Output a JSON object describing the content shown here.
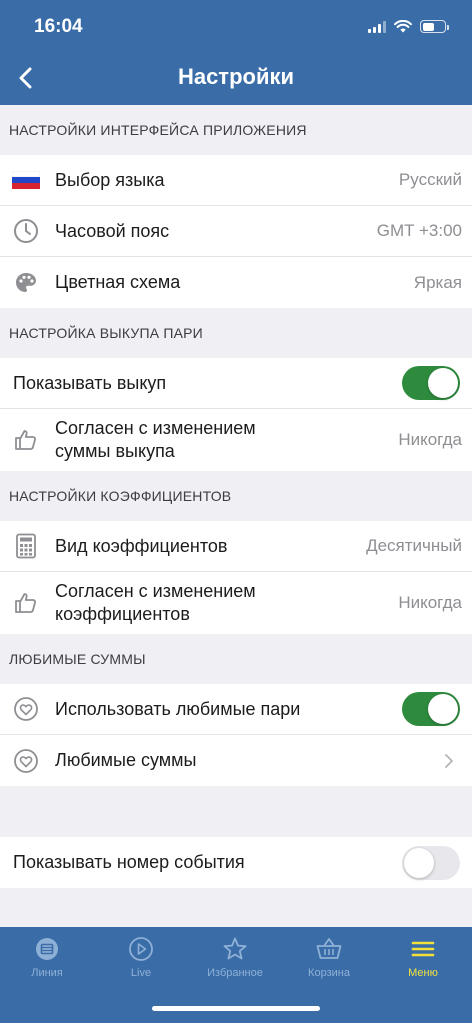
{
  "status": {
    "time": "16:04"
  },
  "nav": {
    "title": "Настройки"
  },
  "sections": {
    "interface": "НАСТРОЙКИ ИНТЕРФЕЙСА ПРИЛОЖЕНИЯ",
    "buyout": "НАСТРОЙКА ВЫКУПА ПАРИ",
    "coefficients": "НАСТРОЙКИ КОЭФФИЦИЕНТОВ",
    "favorites": "ЛЮБИМЫЕ СУММЫ"
  },
  "interface": {
    "language": {
      "label": "Выбор языка",
      "value": "Русский",
      "icon": "russia-flag-icon"
    },
    "timezone": {
      "label": "Часовой пояс",
      "value": "GMT +3:00",
      "icon": "clock-icon"
    },
    "theme": {
      "label": "Цветная схема",
      "value": "Яркая",
      "icon": "palette-icon"
    }
  },
  "buyout": {
    "show": {
      "label": "Показывать выкуп",
      "enabled": true
    },
    "agree": {
      "label_line1": "Согласен с изменением",
      "label_line2": "суммы выкупа",
      "value": "Никогда",
      "icon": "thumbs-up-icon"
    }
  },
  "coefficients": {
    "view": {
      "label": "Вид коэффициентов",
      "value": "Десятичный",
      "icon": "calculator-icon"
    },
    "agree": {
      "label_line1": "Согласен с изменением",
      "label_line2": "коэффициентов",
      "value": "Никогда",
      "icon": "thumbs-up-icon"
    }
  },
  "favorites": {
    "use": {
      "label": "Использовать любимые пари",
      "enabled": true,
      "icon": "heart-icon"
    },
    "sums": {
      "label": "Любимые суммы",
      "icon": "heart-icon"
    }
  },
  "event_number": {
    "label": "Показывать номер события",
    "enabled": false
  },
  "tabs": [
    {
      "label": "Линия",
      "icon": "line-icon",
      "active": false
    },
    {
      "label": "Live",
      "icon": "play-icon",
      "active": false
    },
    {
      "label": "Избранное",
      "icon": "star-icon",
      "active": false
    },
    {
      "label": "Корзина",
      "icon": "basket-icon",
      "active": false
    },
    {
      "label": "Меню",
      "icon": "menu-icon",
      "active": true
    }
  ],
  "colors": {
    "header": "#3a6da8",
    "toggle_on": "#2e8b3e",
    "tab_active": "#f3e13a",
    "tab_inactive": "#8fb0d6"
  }
}
